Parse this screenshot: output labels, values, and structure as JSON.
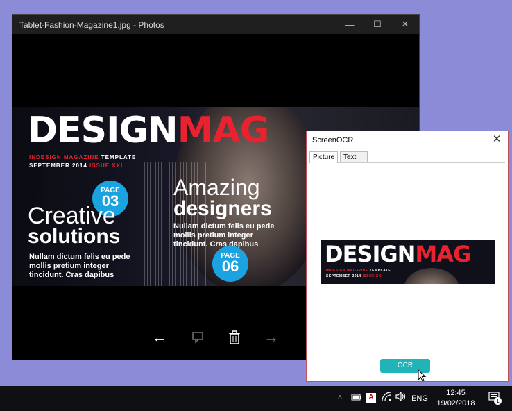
{
  "photos_window": {
    "title": "Tablet-Fashion-Magazine1.jpg - Photos",
    "controls": {
      "minimize": "—",
      "maximize": "☐",
      "close": "✕"
    },
    "magazine": {
      "logo_white": "DESIGN",
      "logo_red": "MAG",
      "tagline_red": "INDESIGN MAGAZINE",
      "tagline_white": "TEMPLATE",
      "issue_white": "SEPTEMBER 2014",
      "issue_red": "ISSUE XXI",
      "page_badge_1": {
        "label": "PAGE",
        "number": "03"
      },
      "page_badge_2": {
        "label": "PAGE",
        "number": "06"
      },
      "headline_1_light": "Creative",
      "headline_1_bold": "solutions",
      "body_1": "Nullam dictum felis eu pede mollis pretium integer tincidunt. Cras dapibus",
      "headline_2_light": "Amazing",
      "headline_2_bold": "designers",
      "body_2": "Nullam dictum felis eu pede mollis pretium integer tincidunt. Cras dapibus"
    },
    "nav": {
      "back": "←",
      "forward": "→"
    }
  },
  "ocr_window": {
    "title": "ScreenOCR",
    "close": "✕",
    "tabs": [
      {
        "label": "Picture"
      },
      {
        "label": "Text"
      }
    ],
    "preview": {
      "logo_white": "DESIGN",
      "logo_red": "MAG",
      "tagline_red": "INDESIGN MAGAZINE",
      "tagline_white": "TEMPLATE",
      "issue_white": "SEPTEMBER 2014",
      "issue_red": "ISSUE XXI"
    },
    "ocr_button": "OCR"
  },
  "taskbar": {
    "tray_chevron": "^",
    "tray_a": "A",
    "language": "ENG",
    "time": "12:45",
    "date": "19/02/2018",
    "notification_count": "1"
  },
  "colors": {
    "desktop": "#8b8bd8",
    "accent_red": "#e8222f",
    "badge_blue": "#1aa3e0",
    "ocr_button": "#22b3b8"
  }
}
